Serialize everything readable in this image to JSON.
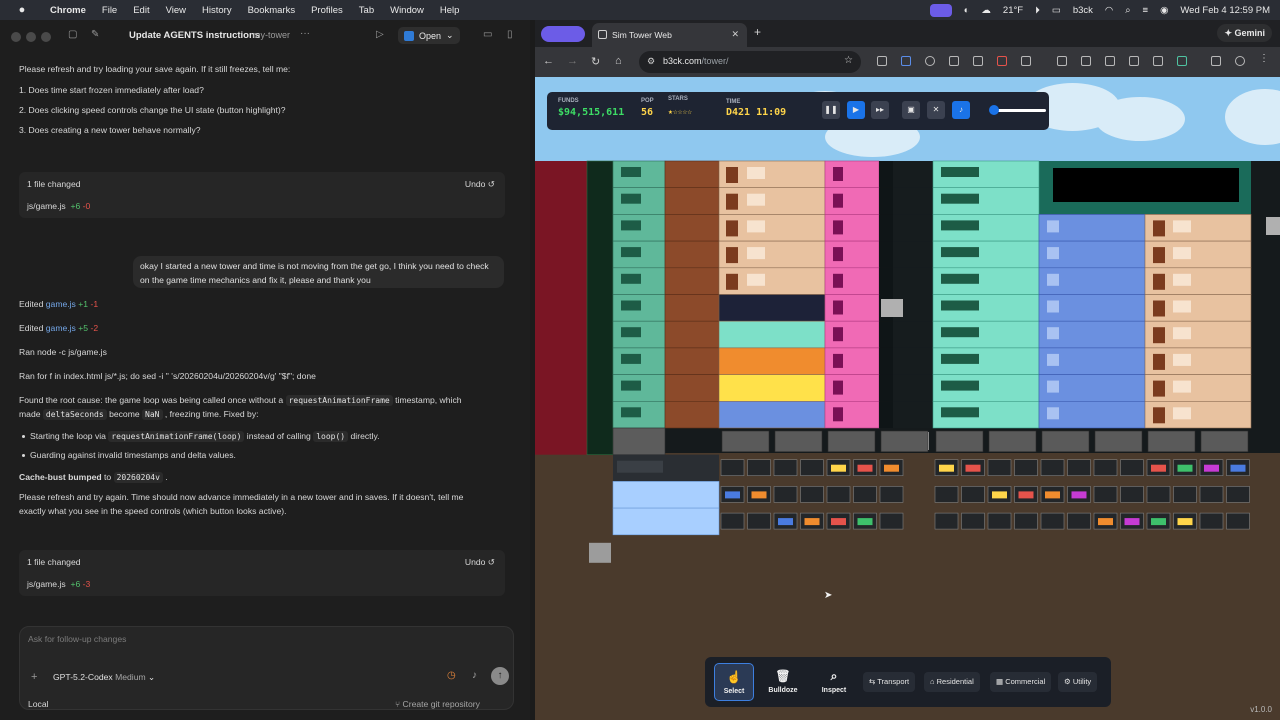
{
  "menubar": {
    "apple": "",
    "app": "Chrome",
    "items": [
      "File",
      "Edit",
      "View",
      "History",
      "Bookmarks",
      "Profiles",
      "Tab",
      "Window",
      "Help"
    ],
    "weather": "21°F",
    "user": "b3ck",
    "datetime": "Wed Feb 4  12:59 PM"
  },
  "codex": {
    "thread_title": "Update AGENTS instructions",
    "project": "my-tower",
    "more": "···",
    "open_label": "Open",
    "intro": "Please refresh and try loading your save again. If it still freezes, tell me:",
    "questions": [
      "1. Does time start frozen immediately after load?",
      "2. Does clicking speed controls change the UI state (button highlight)?",
      "3. Does creating a new tower behave normally?"
    ],
    "card1": {
      "title": "1 file changed",
      "undo": "Undo",
      "file": "js/game.js",
      "add": "+6",
      "del": "-0"
    },
    "user_message": "okay I started a new tower and time is not moving from the get go, I think you need to check on the game time mechanics and fix it, please and thank you",
    "edits": [
      {
        "prefix": "Edited",
        "file": "game.js",
        "add": "+1",
        "del": "-1"
      },
      {
        "prefix": "Edited",
        "file": "game.js",
        "add": "+5",
        "del": "-2"
      }
    ],
    "ran1": "Ran node -c js/game.js",
    "ran2": "Ran for f in index.html js/*.js; do sed -i '' 's/20260204u/20260204v/g' \"$f\"; done",
    "root_cause": {
      "t1": "Found the root cause: the game loop was being called once without a",
      "c1": "requestAnimationFrame",
      "t2": "timestamp, which",
      "t3": "made",
      "c2": "deltaSeconds",
      "t4": "become",
      "c3": "NaN",
      "t5": ", freezing time. Fixed by:"
    },
    "bullet1": {
      "t1": "Starting the loop via",
      "c1": "requestAnimationFrame(loop)",
      "t2": "instead of calling",
      "c2": "loop()",
      "t3": "directly."
    },
    "bullet2": "Guarding against invalid timestamps and delta values.",
    "cache_bust": {
      "label": "Cache-bust bumped",
      "to": "to",
      "value": "20260204v",
      "dot": "."
    },
    "final1": "Please refresh and try again. Time should now advance immediately in a new tower and in saves. If it doesn't, tell me",
    "final2": "exactly what you see in the speed controls (which button looks active).",
    "card2": {
      "title": "1 file changed",
      "undo": "Undo",
      "file": "js/game.js",
      "add": "+6",
      "del": "-3"
    },
    "composer_placeholder": "Ask for follow-up changes",
    "model": "GPT-5.2-Codex",
    "effort": "Medium",
    "footer_local": "Local",
    "footer_git": "Create git repository"
  },
  "browser": {
    "tab_title": "Sim Tower Web",
    "url_host": "b3ck.com",
    "url_path": "/tower/",
    "gemini": "Gemini"
  },
  "game": {
    "funds_label": "FUNDS",
    "funds": "$94,515,611",
    "pop_label": "POP",
    "pop": "56",
    "stars_label": "STARS",
    "stars": "★☆☆☆☆",
    "time_label": "TIME",
    "time": "D421 11:09",
    "version": "v1.0.0",
    "tools": [
      {
        "label": "Select",
        "icon": "☝"
      },
      {
        "label": "Bulldoze",
        "icon": "🗑"
      },
      {
        "label": "Inspect",
        "icon": "⌕"
      }
    ],
    "categories": [
      {
        "label": "Transport",
        "icon": "⇆"
      },
      {
        "label": "Residential",
        "icon": "⌂"
      },
      {
        "label": "Commercial",
        "icon": "▦"
      },
      {
        "label": "Utility",
        "icon": "⚙"
      }
    ]
  }
}
